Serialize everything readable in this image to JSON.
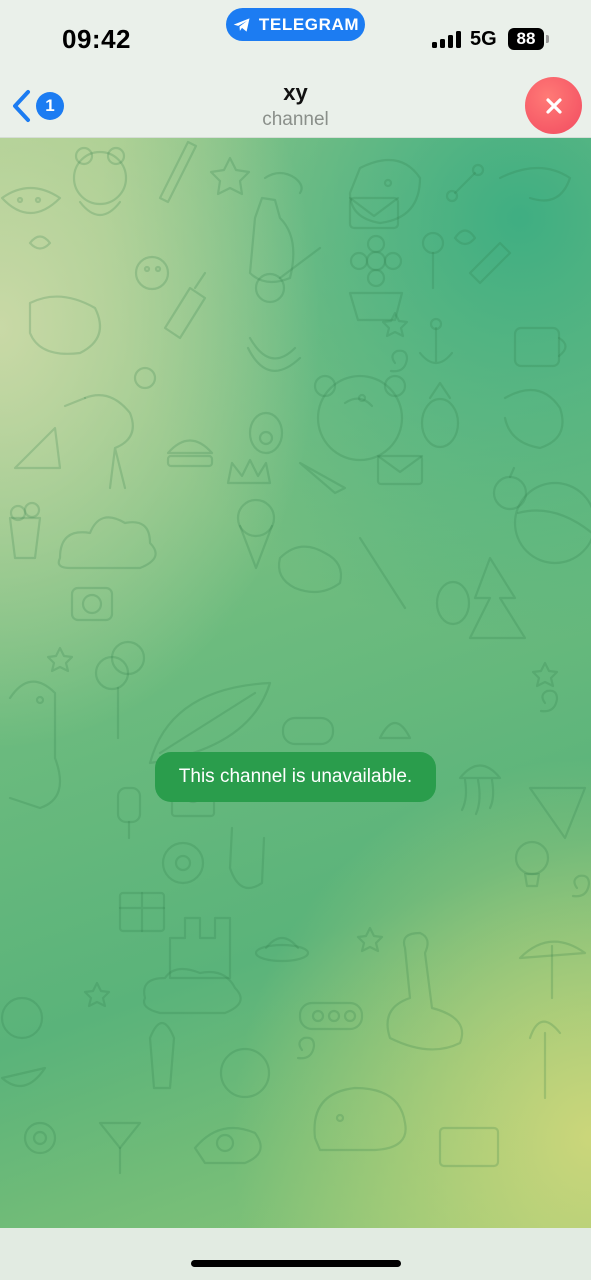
{
  "status_bar": {
    "time": "09:42",
    "app_pill": "TELEGRAM",
    "network": "5G",
    "battery": "88",
    "accent": "#1c7cf2"
  },
  "header": {
    "back_count": "1",
    "title": "xy",
    "subtitle": "channel",
    "close_color": "#f24b60"
  },
  "chat": {
    "notice": "This channel is unavailable.",
    "notice_color": "#2a9d4c"
  },
  "icons": {
    "back": "chevron-left-icon",
    "close": "close-icon",
    "pill": "telegram-plane-icon"
  }
}
